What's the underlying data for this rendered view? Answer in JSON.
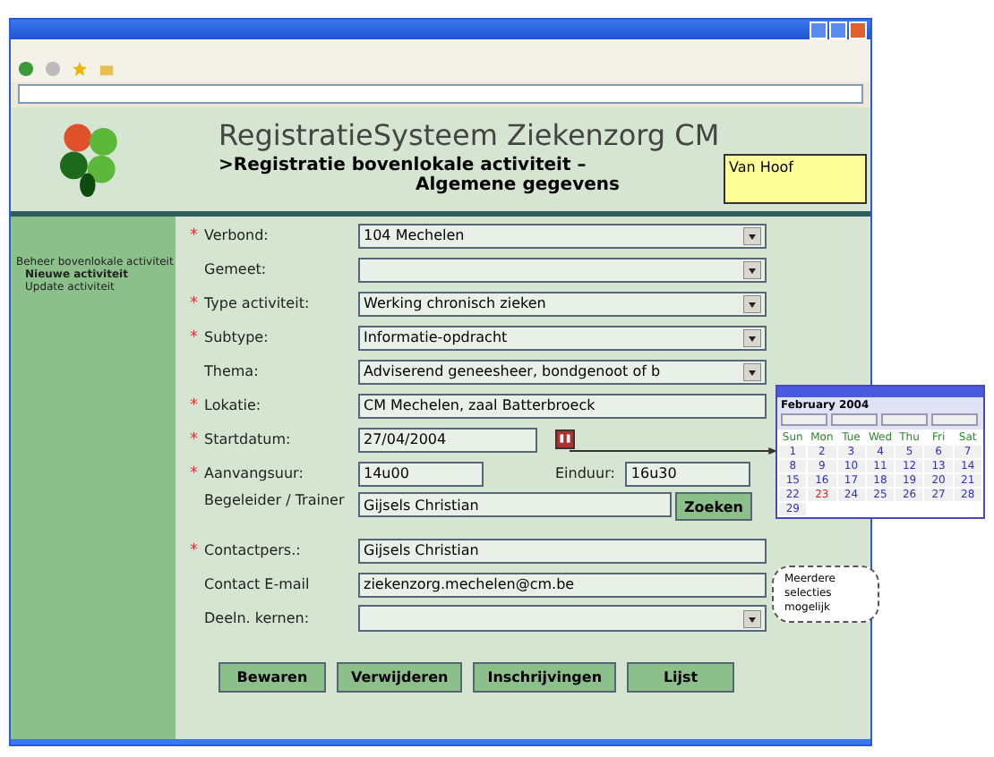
{
  "app": {
    "title": "RegistratieSysteem Ziekenzorg CM",
    "subtitle_line1": ">Registratie bovenlokale activiteit –",
    "subtitle_line2": "Algemene gegevens",
    "user": "Van Hoof"
  },
  "sidebar": {
    "items": [
      {
        "label": "Beheer bovenlokale activiteit",
        "selected": false,
        "children": [
          {
            "label": "Nieuwe activiteit",
            "selected": true
          },
          {
            "label": "Update activiteit",
            "selected": false
          }
        ]
      }
    ]
  },
  "form": {
    "required_mark": "*",
    "fields": [
      {
        "kind": "select",
        "label": "Verbond:",
        "required": true,
        "value": "104 Mechelen"
      },
      {
        "kind": "select",
        "label": "Gemeet:",
        "required": false
      },
      {
        "kind": "select",
        "label": "Type activiteit:",
        "required": true,
        "value": "Werking chronisch zieken"
      },
      {
        "kind": "select",
        "label": "Subtype:",
        "required": true,
        "value": "Informatie-opdracht"
      },
      {
        "kind": "select",
        "label": "Thema:",
        "required": false,
        "value": "Adviserend  geneesheer, bondgenoot of b"
      },
      {
        "kind": "text",
        "label": "Lokatie:",
        "required": true,
        "value": "CM Mechelen, zaal Batterbroeck"
      },
      {
        "kind": "date",
        "label": "Startdatum:",
        "required": true,
        "value": "27/04/2004"
      },
      {
        "kind": "time-range",
        "label": "Aanvangsuur:",
        "required": true,
        "value": "14u00",
        "end_label": "Einduur:",
        "end_value": "16u30"
      },
      {
        "kind": "search",
        "label": "Begeleider / Trainer",
        "required": false,
        "value": "Gijsels Christian",
        "button": "Zoeken"
      },
      {
        "kind": "text",
        "label": "Contactpers.:",
        "required": true,
        "value": "Gijsels Christian"
      },
      {
        "kind": "text",
        "label": "Contact E-mail",
        "required": false,
        "value": "ziekenzorg.mechelen@cm.be"
      },
      {
        "kind": "multiselect",
        "label": "Deeln. kernen:",
        "required": false
      }
    ],
    "buttons": [
      "Bewaren",
      "Verwijderen",
      "Inschrijvingen",
      "Lijst"
    ]
  },
  "calendar": {
    "month": "February 2004",
    "weekdays": [
      "Sun",
      "Mon",
      "Tue",
      "Wed",
      "Thu",
      "Fri",
      "Sat"
    ],
    "weeks": [
      [
        {
          "day": "1",
          "selected": false
        },
        {
          "day": "2",
          "selected": false
        },
        {
          "day": "3",
          "selected": false
        },
        {
          "day": "4",
          "selected": false
        },
        {
          "day": "5",
          "selected": false
        },
        {
          "day": "6",
          "selected": false
        },
        {
          "day": "7",
          "selected": false
        }
      ],
      [
        {
          "day": "8",
          "selected": false
        },
        {
          "day": "9",
          "selected": false
        },
        {
          "day": "10",
          "selected": false
        },
        {
          "day": "11",
          "selected": false
        },
        {
          "day": "12",
          "selected": false
        },
        {
          "day": "13",
          "selected": false
        },
        {
          "day": "14",
          "selected": false
        }
      ],
      [
        {
          "day": "15",
          "selected": false
        },
        {
          "day": "16",
          "selected": false
        },
        {
          "day": "17",
          "selected": false
        },
        {
          "day": "18",
          "selected": false
        },
        {
          "day": "19",
          "selected": false
        },
        {
          "day": "20",
          "selected": false
        },
        {
          "day": "21",
          "selected": false
        }
      ],
      [
        {
          "day": "22",
          "selected": false
        },
        {
          "day": "23",
          "selected": true
        },
        {
          "day": "24",
          "selected": false
        },
        {
          "day": "25",
          "selected": false
        },
        {
          "day": "26",
          "selected": false
        },
        {
          "day": "27",
          "selected": false
        },
        {
          "day": "28",
          "selected": false
        }
      ],
      [
        {
          "day": "29",
          "selected": false
        }
      ]
    ]
  },
  "callout": {
    "text": "Meerdere selecties mogelijk"
  }
}
